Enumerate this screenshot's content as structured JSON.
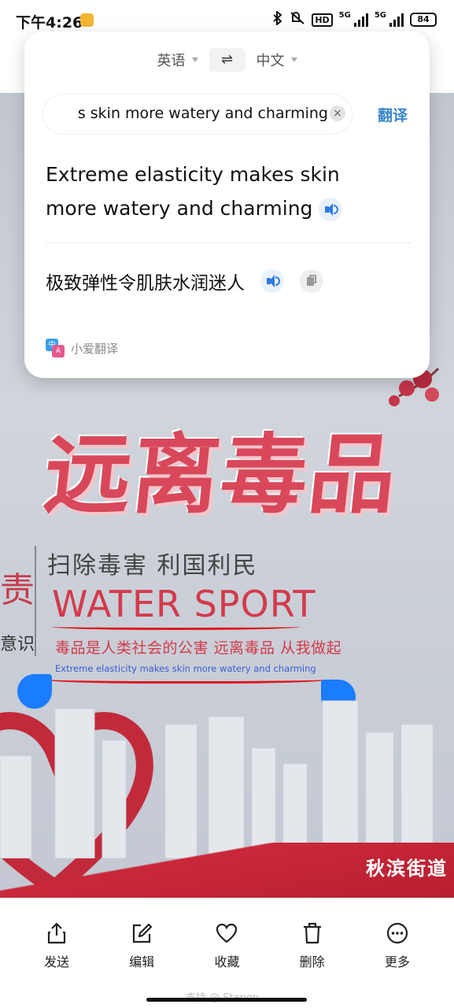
{
  "status_bar": {
    "time": "下午4:26",
    "hd_label": "HD",
    "network1": "5G",
    "network2": "5G",
    "battery": "84"
  },
  "translator": {
    "source_lang": "英语",
    "target_lang": "中文",
    "swap_symbol": "⇌",
    "input_text": "s skin more watery and charming",
    "clear_symbol": "×",
    "translate_button": "翻译",
    "result_en": "Extreme elasticity makes skin more watery and charming",
    "result_zh": "极致弹性令肌肤水润迷人",
    "brand": "小爱翻译",
    "brand_logo_text_a": "中",
    "brand_logo_text_b": "A"
  },
  "photo": {
    "headline": "远离毒品",
    "left_char": "责",
    "left_word": "意识",
    "slogan1": "扫除毒害 利国利民",
    "big_english": "WATER SPORT",
    "slogan2": "毒品是人类社会的公害 远离毒品 从我做起",
    "small_english": "Extreme elasticity makes skin more watery and charming",
    "street": "秋滨街道"
  },
  "toolbar": {
    "items": [
      {
        "label": "发送",
        "icon": "share-icon"
      },
      {
        "label": "编辑",
        "icon": "edit-icon"
      },
      {
        "label": "收藏",
        "icon": "heart-icon"
      },
      {
        "label": "删除",
        "icon": "trash-icon"
      },
      {
        "label": "更多",
        "icon": "more-icon"
      }
    ],
    "watermark": "支持 @ Stanon"
  },
  "colors": {
    "accent_blue": "#3a86c8",
    "handle_blue": "#1a7cff",
    "headline_red": "#d8485a"
  }
}
